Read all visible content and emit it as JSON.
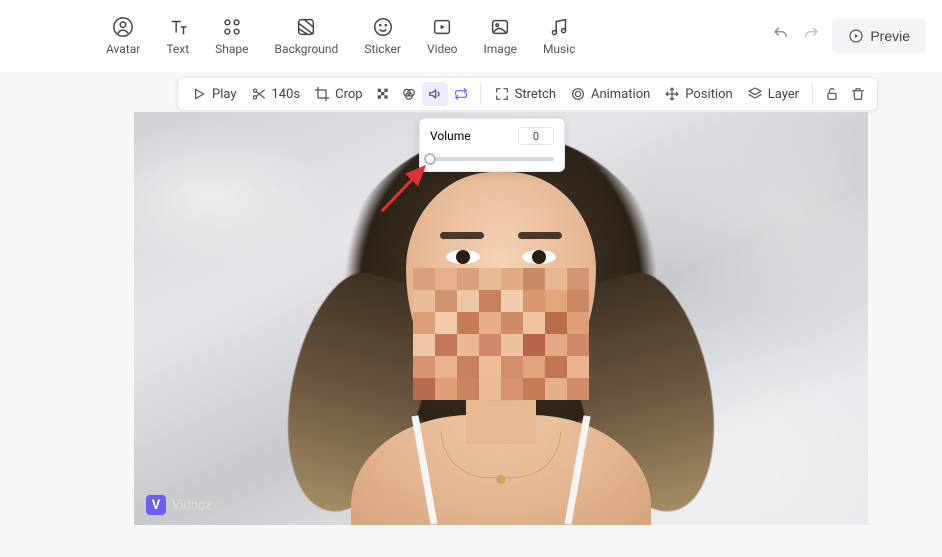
{
  "tabs": {
    "avatar": "Avatar",
    "text": "Text",
    "shape": "Shape",
    "background": "Background",
    "sticker": "Sticker",
    "video": "Video",
    "image": "Image",
    "music": "Music"
  },
  "buttons": {
    "preview": "Previe"
  },
  "toolbar": {
    "play": "Play",
    "duration": "140s",
    "crop": "Crop",
    "stretch": "Stretch",
    "animation": "Animation",
    "position": "Position",
    "layer": "Layer"
  },
  "popover": {
    "label": "Volume",
    "value": "0"
  },
  "watermark": {
    "badge": "V",
    "text": "Vidnoz"
  },
  "mosaic_colors": [
    "#d7a07a",
    "#e4b18b",
    "#d9a17b",
    "#e7b994",
    "#e2ab84",
    "#c98b66",
    "#e7b692",
    "#d49774",
    "#e9bb98",
    "#d19270",
    "#efc6a5",
    "#c7815e",
    "#f1cdaf",
    "#d8996f",
    "#e2a67f",
    "#cc8763",
    "#de9e77",
    "#f1caa9",
    "#c67a57",
    "#e6af87",
    "#d18b67",
    "#efc2a0",
    "#bb6c4c",
    "#dfa079",
    "#efc6a6",
    "#c4795a",
    "#eab791",
    "#d08968",
    "#edc2a0",
    "#b6654a",
    "#e3a985",
    "#ce8a66",
    "#d79571",
    "#e8b28d",
    "#c9805f",
    "#eebd99",
    "#d38f6c",
    "#e0a37e",
    "#c27553",
    "#e8b490",
    "#b76a4f",
    "#df9f79",
    "#ca8462",
    "#ebba96",
    "#d69370",
    "#c57a58",
    "#e5af89",
    "#d28d6a"
  ]
}
